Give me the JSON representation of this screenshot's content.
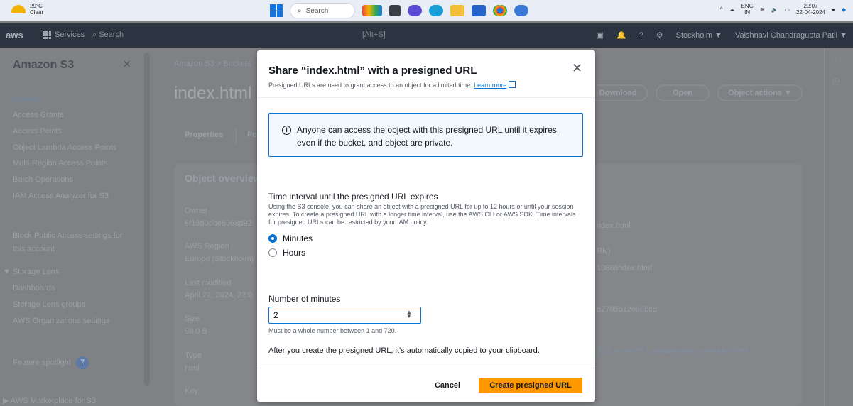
{
  "taskbar": {
    "weather_temp": "29°C",
    "weather_cond": "Clear",
    "search_placeholder": "Search",
    "lang_line1": "ENG",
    "lang_line2": "IN",
    "time": "22:07",
    "date": "22-04-2024"
  },
  "aws_nav": {
    "logo": "aws",
    "services_label": "Services",
    "search_label": "Search",
    "shortcut": "[Alt+S]",
    "region": "Stockholm ▼",
    "user": "Vaishnavi Chandragupta Patil ▼"
  },
  "sidebar": {
    "title": "Amazon S3",
    "items": [
      "Buckets",
      "Access Grants",
      "Access Points",
      "Object Lambda Access Points",
      "Multi-Region Access Points",
      "Batch Operations",
      "IAM Access Analyzer for S3",
      "Block Public Access settings for",
      "this account",
      "▼ Storage Lens",
      "Dashboards",
      "Storage Lens groups",
      "AWS Organizations settings",
      "Feature spotlight",
      "▶ AWS Marketplace for S3"
    ],
    "spotlight_badge": "7"
  },
  "background": {
    "breadcrumb": "Amazon S3  >  Buckets",
    "page_title": "index.html",
    "tab_properties": "Properties",
    "tab_permissions": "Pe",
    "overview_title": "Object overview",
    "download_label": "Download",
    "open_label": "Open",
    "actions_label": "Object actions ▼",
    "owner_label": "Owner",
    "owner_value": "6f13d0dbe5068d92",
    "region_label": "AWS Region",
    "region_value": "Europe (Stockholm)",
    "modified_label": "Last modified",
    "modified_value": "April 22, 2024, 22:0",
    "size_label": "Size",
    "size_value": "98.0 B",
    "type_label": "Type",
    "type_value": "html",
    "key_label": "Key",
    "right_val1": "ndex.html",
    "right_val2": "RN)",
    "right_val3": "1086/index.html",
    "right_val4": "e2705b12e96bc8",
    "right_val5": "6.s3.eu-north-1.amazonaws.com/index.html"
  },
  "modal": {
    "title": "Share “index.html” with a presigned URL",
    "subtitle": "Presigned URLs are used to grant access to an object for a limited time.",
    "learn_more": "Learn more",
    "info_text": "Anyone can access the object with this presigned URL until it expires, even if the bucket, and object are private.",
    "interval_title": "Time interval until the presigned URL expires",
    "interval_desc": "Using the S3 console, you can share an object with a presigned URL for up to 12 hours or until your session expires. To create a presigned URL with a longer time interval, use the AWS CLI or AWS SDK. Time intervals for presigned URLs can be restricted by your IAM policy.",
    "radio_minutes": "Minutes",
    "radio_hours": "Hours",
    "minutes_label": "Number of minutes",
    "minutes_value": "2",
    "minutes_hint": "Must be a whole number between 1 and 720.",
    "clipboard_note": "After you create the presigned URL, it's automatically copied to your clipboard.",
    "cancel_label": "Cancel",
    "create_label": "Create presigned URL"
  },
  "colors": {
    "accent": "#0972d3",
    "primary_button": "#ff9900"
  }
}
